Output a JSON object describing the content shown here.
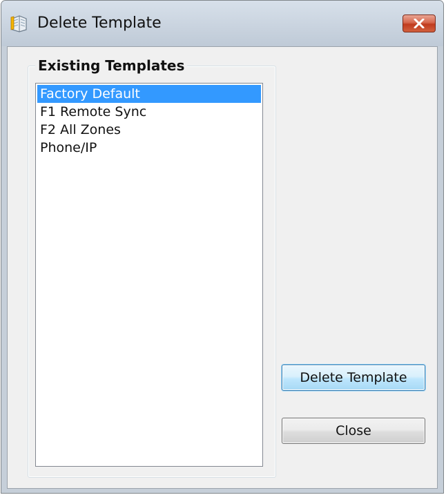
{
  "window": {
    "title": "Delete Template",
    "icon": "template-book-icon",
    "close_icon": "close-icon",
    "close_button_color": "#c9452a"
  },
  "group": {
    "label": "Existing Templates"
  },
  "templates": [
    {
      "label": "Factory Default",
      "selected": true
    },
    {
      "label": "F1 Remote Sync",
      "selected": false
    },
    {
      "label": "F2 All Zones",
      "selected": false
    },
    {
      "label": "Phone/IP",
      "selected": false
    }
  ],
  "buttons": {
    "delete_label": "Delete Template",
    "close_label": "Close"
  },
  "colors": {
    "selection": "#3399ff",
    "focused_button_border": "#3c7fb1"
  }
}
